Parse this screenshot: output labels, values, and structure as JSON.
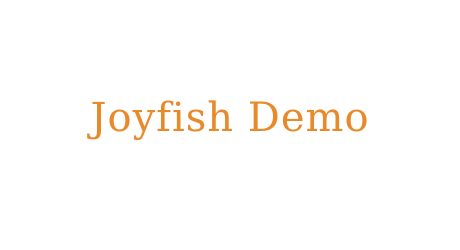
{
  "preview": {
    "text": "Joyfish Demo",
    "color": "#e8892a"
  }
}
